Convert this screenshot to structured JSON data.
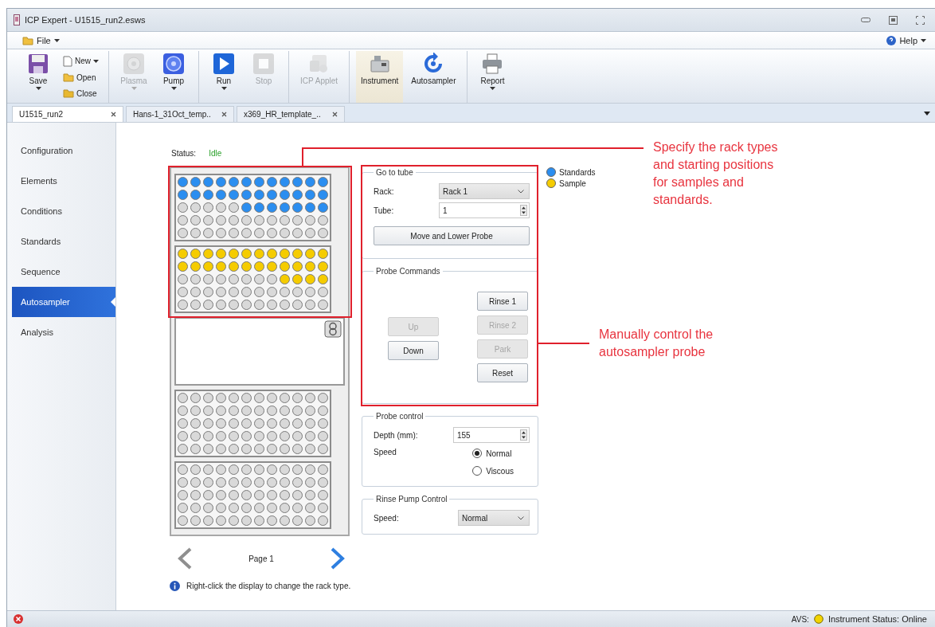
{
  "window": {
    "title": "ICP Expert - U1515_run2.esws"
  },
  "menu": {
    "file": "File",
    "help": "Help"
  },
  "ribbon": {
    "groups": [
      {
        "items": [
          {
            "kind": "large",
            "label": "Save",
            "disabled": false,
            "selected": false,
            "dropdown": true
          },
          {
            "kind": "stack",
            "items": [
              {
                "label": "New",
                "dropdown": true
              },
              {
                "label": "Open",
                "dropdown": false
              },
              {
                "label": "Close",
                "dropdown": false
              }
            ]
          }
        ]
      },
      {
        "items": [
          {
            "kind": "large",
            "label": "Plasma",
            "disabled": true,
            "selected": false,
            "dropdown": true
          },
          {
            "kind": "large",
            "label": "Pump",
            "disabled": false,
            "selected": false,
            "dropdown": true
          }
        ]
      },
      {
        "items": [
          {
            "kind": "large",
            "label": "Run",
            "disabled": false,
            "selected": false,
            "dropdown": true
          },
          {
            "kind": "large",
            "label": "Stop",
            "disabled": true,
            "selected": false,
            "dropdown": false
          }
        ]
      },
      {
        "items": [
          {
            "kind": "large",
            "label": "ICP Applet",
            "disabled": true,
            "selected": false,
            "dropdown": false
          }
        ]
      },
      {
        "items": [
          {
            "kind": "large",
            "label": "Instrument",
            "disabled": false,
            "selected": true,
            "dropdown": false
          },
          {
            "kind": "large",
            "label": "Autosampler",
            "disabled": false,
            "selected": false,
            "dropdown": false
          }
        ]
      },
      {
        "items": [
          {
            "kind": "large",
            "label": "Report",
            "disabled": false,
            "selected": false,
            "dropdown": true
          }
        ]
      }
    ]
  },
  "tabs": [
    {
      "label": "U1515_run2",
      "selected": true
    },
    {
      "label": "Hans-1_31Oct_temp..",
      "selected": false
    },
    {
      "label": "x369_HR_template_..",
      "selected": false
    }
  ],
  "sidebar": {
    "items": [
      {
        "label": "Configuration",
        "selected": false
      },
      {
        "label": "Elements",
        "selected": false
      },
      {
        "label": "Conditions",
        "selected": false
      },
      {
        "label": "Standards",
        "selected": false
      },
      {
        "label": "Sequence",
        "selected": false
      },
      {
        "label": "Autosampler",
        "selected": true
      },
      {
        "label": "Analysis",
        "selected": false
      }
    ]
  },
  "autosampler": {
    "status_label": "Status:",
    "status_value": "Idle",
    "tray": [
      {
        "kind": "rack",
        "color": "#2b8ef0",
        "rows": [
          [
            {
              "filled": true
            },
            {
              "filled": true
            },
            {
              "filled": true
            },
            {
              "filled": true
            },
            {
              "filled": true
            },
            {
              "filled": true
            },
            {
              "filled": true
            },
            {
              "filled": true
            },
            {
              "filled": true
            },
            {
              "filled": true
            },
            {
              "filled": true
            },
            {
              "filled": true
            }
          ],
          [
            {
              "filled": true
            },
            {
              "filled": true
            },
            {
              "filled": true
            },
            {
              "filled": true
            },
            {
              "filled": true
            },
            {
              "filled": true
            },
            {
              "filled": true
            },
            {
              "filled": true
            },
            {
              "filled": true
            },
            {
              "filled": true
            },
            {
              "filled": true
            },
            {
              "filled": true
            }
          ],
          [
            {
              "filled": false
            },
            {
              "filled": false
            },
            {
              "filled": false
            },
            {
              "filled": false
            },
            {
              "filled": false
            },
            {
              "filled": true
            },
            {
              "filled": true
            },
            {
              "filled": true
            },
            {
              "filled": true
            },
            {
              "filled": true
            },
            {
              "filled": true
            },
            {
              "filled": true
            }
          ],
          [
            {
              "filled": false
            },
            {
              "filled": false
            },
            {
              "filled": false
            },
            {
              "filled": false
            },
            {
              "filled": false
            },
            {
              "filled": false
            },
            {
              "filled": false
            },
            {
              "filled": false
            },
            {
              "filled": false
            },
            {
              "filled": false
            },
            {
              "filled": false
            },
            {
              "filled": false
            }
          ],
          [
            {
              "filled": false
            },
            {
              "filled": false
            },
            {
              "filled": false
            },
            {
              "filled": false
            },
            {
              "filled": false
            },
            {
              "filled": false
            },
            {
              "filled": false
            },
            {
              "filled": false
            },
            {
              "filled": false
            },
            {
              "filled": false
            },
            {
              "filled": false
            },
            {
              "filled": false
            }
          ]
        ]
      },
      {
        "kind": "rack",
        "color": "#f5cc00",
        "rows": [
          [
            {
              "filled": true
            },
            {
              "filled": true
            },
            {
              "filled": true
            },
            {
              "filled": true
            },
            {
              "filled": true
            },
            {
              "filled": true
            },
            {
              "filled": true
            },
            {
              "filled": true
            },
            {
              "filled": true
            },
            {
              "filled": true
            },
            {
              "filled": true
            },
            {
              "filled": true
            }
          ],
          [
            {
              "filled": true
            },
            {
              "filled": true
            },
            {
              "filled": true
            },
            {
              "filled": true
            },
            {
              "filled": true
            },
            {
              "filled": true
            },
            {
              "filled": true
            },
            {
              "filled": true
            },
            {
              "filled": true
            },
            {
              "filled": true
            },
            {
              "filled": true
            },
            {
              "filled": true
            }
          ],
          [
            {
              "filled": false
            },
            {
              "filled": false
            },
            {
              "filled": false
            },
            {
              "filled": false
            },
            {
              "filled": false
            },
            {
              "filled": false
            },
            {
              "filled": false
            },
            {
              "filled": false
            },
            {
              "filled": true
            },
            {
              "filled": true
            },
            {
              "filled": true
            },
            {
              "filled": true
            }
          ],
          [
            {
              "filled": false
            },
            {
              "filled": false
            },
            {
              "filled": false
            },
            {
              "filled": false
            },
            {
              "filled": false
            },
            {
              "filled": false
            },
            {
              "filled": false
            },
            {
              "filled": false
            },
            {
              "filled": false
            },
            {
              "filled": false
            },
            {
              "filled": false
            },
            {
              "filled": false
            }
          ],
          [
            {
              "filled": false
            },
            {
              "filled": false
            },
            {
              "filled": false
            },
            {
              "filled": false
            },
            {
              "filled": false
            },
            {
              "filled": false
            },
            {
              "filled": false
            },
            {
              "filled": false
            },
            {
              "filled": false
            },
            {
              "filled": false
            },
            {
              "filled": false
            },
            {
              "filled": false
            }
          ]
        ]
      },
      {
        "kind": "station"
      },
      {
        "kind": "rack",
        "rows": [
          [
            {
              "filled": false
            },
            {
              "filled": false
            },
            {
              "filled": false
            },
            {
              "filled": false
            },
            {
              "filled": false
            },
            {
              "filled": false
            },
            {
              "filled": false
            },
            {
              "filled": false
            },
            {
              "filled": false
            },
            {
              "filled": false
            },
            {
              "filled": false
            },
            {
              "filled": false
            }
          ],
          [
            {
              "filled": false
            },
            {
              "filled": false
            },
            {
              "filled": false
            },
            {
              "filled": false
            },
            {
              "filled": false
            },
            {
              "filled": false
            },
            {
              "filled": false
            },
            {
              "filled": false
            },
            {
              "filled": false
            },
            {
              "filled": false
            },
            {
              "filled": false
            },
            {
              "filled": false
            }
          ],
          [
            {
              "filled": false
            },
            {
              "filled": false
            },
            {
              "filled": false
            },
            {
              "filled": false
            },
            {
              "filled": false
            },
            {
              "filled": false
            },
            {
              "filled": false
            },
            {
              "filled": false
            },
            {
              "filled": false
            },
            {
              "filled": false
            },
            {
              "filled": false
            },
            {
              "filled": false
            }
          ],
          [
            {
              "filled": false
            },
            {
              "filled": false
            },
            {
              "filled": false
            },
            {
              "filled": false
            },
            {
              "filled": false
            },
            {
              "filled": false
            },
            {
              "filled": false
            },
            {
              "filled": false
            },
            {
              "filled": false
            },
            {
              "filled": false
            },
            {
              "filled": false
            },
            {
              "filled": false
            }
          ],
          [
            {
              "filled": false
            },
            {
              "filled": false
            },
            {
              "filled": false
            },
            {
              "filled": false
            },
            {
              "filled": false
            },
            {
              "filled": false
            },
            {
              "filled": false
            },
            {
              "filled": false
            },
            {
              "filled": false
            },
            {
              "filled": false
            },
            {
              "filled": false
            },
            {
              "filled": false
            }
          ]
        ]
      },
      {
        "kind": "rack",
        "rows": [
          [
            {
              "filled": false
            },
            {
              "filled": false
            },
            {
              "filled": false
            },
            {
              "filled": false
            },
            {
              "filled": false
            },
            {
              "filled": false
            },
            {
              "filled": false
            },
            {
              "filled": false
            },
            {
              "filled": false
            },
            {
              "filled": false
            },
            {
              "filled": false
            },
            {
              "filled": false
            }
          ],
          [
            {
              "filled": false
            },
            {
              "filled": false
            },
            {
              "filled": false
            },
            {
              "filled": false
            },
            {
              "filled": false
            },
            {
              "filled": false
            },
            {
              "filled": false
            },
            {
              "filled": false
            },
            {
              "filled": false
            },
            {
              "filled": false
            },
            {
              "filled": false
            },
            {
              "filled": false
            }
          ],
          [
            {
              "filled": false
            },
            {
              "filled": false
            },
            {
              "filled": false
            },
            {
              "filled": false
            },
            {
              "filled": false
            },
            {
              "filled": false
            },
            {
              "filled": false
            },
            {
              "filled": false
            },
            {
              "filled": false
            },
            {
              "filled": false
            },
            {
              "filled": false
            },
            {
              "filled": false
            }
          ],
          [
            {
              "filled": false
            },
            {
              "filled": false
            },
            {
              "filled": false
            },
            {
              "filled": false
            },
            {
              "filled": false
            },
            {
              "filled": false
            },
            {
              "filled": false
            },
            {
              "filled": false
            },
            {
              "filled": false
            },
            {
              "filled": false
            },
            {
              "filled": false
            },
            {
              "filled": false
            }
          ],
          [
            {
              "filled": false
            },
            {
              "filled": false
            },
            {
              "filled": false
            },
            {
              "filled": false
            },
            {
              "filled": false
            },
            {
              "filled": false
            },
            {
              "filled": false
            },
            {
              "filled": false
            },
            {
              "filled": false
            },
            {
              "filled": false
            },
            {
              "filled": false
            },
            {
              "filled": false
            }
          ]
        ]
      }
    ],
    "pager": {
      "label": "Page 1",
      "prev_disabled": true,
      "next_disabled": false
    },
    "hint": "Right-click the display to change the rack type."
  },
  "go_to_tube": {
    "title": "Go to tube",
    "rack_label": "Rack:",
    "rack_value": "Rack 1",
    "tube_label": "Tube:",
    "tube_value": "1",
    "button": "Move and Lower Probe"
  },
  "probe_commands": {
    "title": "Probe Commands",
    "left_buttons": [
      {
        "label": "Up",
        "disabled": true
      },
      {
        "label": "Down",
        "disabled": false
      }
    ],
    "right_buttons": [
      {
        "label": "Rinse 1",
        "disabled": false
      },
      {
        "label": "Rinse 2",
        "disabled": true
      },
      {
        "label": "Park",
        "disabled": true
      },
      {
        "label": "Reset",
        "disabled": false
      }
    ]
  },
  "probe_control": {
    "title": "Probe control",
    "depth_label": "Depth (mm):",
    "depth_value": "155",
    "speed_label": "Speed",
    "speed_options": [
      {
        "label": "Normal",
        "selected": true
      },
      {
        "label": "Viscous",
        "selected": false
      }
    ]
  },
  "rinse_pump": {
    "title": "Rinse Pump Control",
    "speed_label": "Speed:",
    "speed_value": "Normal"
  },
  "legend": [
    {
      "label": "Standards",
      "color": "#2b8ef0"
    },
    {
      "label": "Sample",
      "color": "#f5cc00"
    }
  ],
  "status_bar": {
    "avs_label": "AVS:",
    "instrument_status": "Instrument Status: Online"
  },
  "annotations": [
    {
      "text": "Specify the rack types and starting positions for samples and standards."
    },
    {
      "text": "Manually control the autosampler probe"
    }
  ]
}
